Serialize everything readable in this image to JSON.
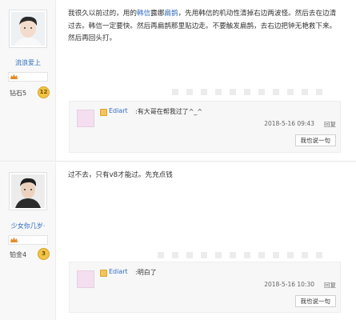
{
  "posts": [
    {
      "user": {
        "name": "流浪爱上",
        "rank": "钻石5",
        "rank_level": "12"
      },
      "content": {
        "p1": "我很久以前过的，用的",
        "hl1": "韩信",
        "p2": "露娜",
        "hl2": "扁鹊",
        "p3": "，先用韩信的机动性清掉右边两波怪。然后去在边清过去。韩信一定要快。然后再扁鹊那里贴边走。不要触发扁鹊，去右边把钟无艳救下来。然后再回头打。"
      },
      "reply": {
        "user": "Ediart",
        "text": ":有大哥在帮我过了^_^",
        "time": "2018-5-16 09:43",
        "action": "回复",
        "button": "我也说一句"
      }
    },
    {
      "user": {
        "name": "少女你几岁·",
        "rank": "铂金4",
        "rank_level": "3"
      },
      "content": {
        "p1": "过不去，只有v8才能过。先充点钱"
      },
      "reply": {
        "user": "Ediart",
        "text": ":明白了",
        "time": "2018-5-16 10:30",
        "action": "回复",
        "button": "我也说一句"
      }
    }
  ],
  "colors": {
    "link": "#2f6ebf",
    "badge": "#f0c448"
  }
}
